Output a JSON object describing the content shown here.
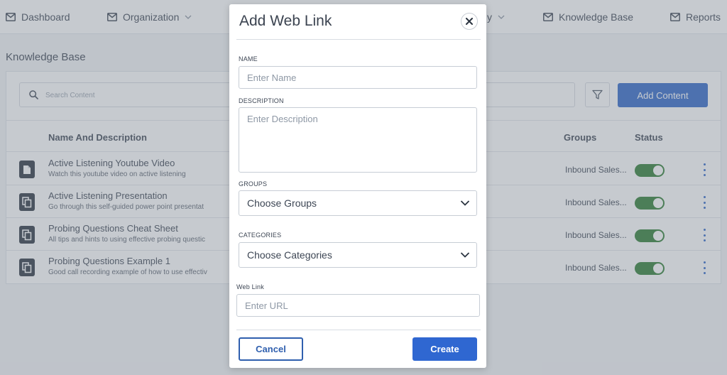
{
  "nav": {
    "items": [
      {
        "label": "Dashboard",
        "icon": "mail-icon"
      },
      {
        "label": "Organization",
        "icon": "mail-icon"
      },
      {
        "label": "y",
        "icon": "chevron-down-icon"
      },
      {
        "label": "Knowledge Base",
        "icon": "mail-icon"
      },
      {
        "label": "Reports",
        "icon": "mail-icon"
      }
    ]
  },
  "page": {
    "title": "Knowledge Base"
  },
  "toolbar": {
    "search_placeholder": "Search Content",
    "filter_icon": "filter-icon",
    "add_label": "Add Content"
  },
  "table": {
    "headers": {
      "name": "Name And Description",
      "groups": "Groups",
      "status": "Status"
    },
    "rows": [
      {
        "name": "Active Listening Youtube Video",
        "description": "Watch this youtube video on active listening",
        "group": "Inbound Sales...",
        "status_on": true,
        "icon": "document-icon"
      },
      {
        "name": "Active Listening Presentation",
        "description": "Go through this self-guided power point presentat",
        "group": "Inbound Sales...",
        "status_on": true,
        "icon": "copy-icon"
      },
      {
        "name": "Probing Questions Cheat Sheet",
        "description": "All tips and hints to using effective probing questic",
        "group": "Inbound Sales...",
        "status_on": true,
        "icon": "copy-icon"
      },
      {
        "name": "Probing Questions Example 1",
        "description": "Good call recording example of how to use effectiv",
        "group": "Inbound Sales...",
        "status_on": true,
        "icon": "copy-icon"
      }
    ]
  },
  "modal": {
    "title": "Add Web Link",
    "name_label": "NAME",
    "name_placeholder": "Enter Name",
    "description_label": "DESCRIPTION",
    "description_placeholder": "Enter Description",
    "groups_label": "GROUPS",
    "groups_value": "Choose Groups",
    "categories_label": "CATEGORIES",
    "categories_value": "Choose Categories",
    "weblink_label": "Web Link",
    "weblink_placeholder": "Enter URL",
    "cancel_label": "Cancel",
    "create_label": "Create"
  },
  "colors": {
    "primary": "#2f67c8",
    "toggle_on": "#2e7d32",
    "overlay": "rgba(120,128,140,0.42)"
  }
}
